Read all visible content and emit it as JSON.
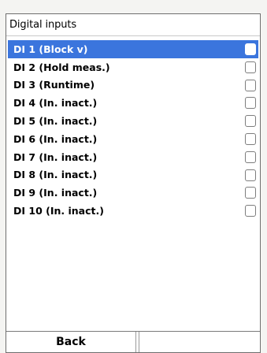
{
  "screen": {
    "title": "Digital inputs"
  },
  "items": [
    {
      "label": "DI 1 (Block v)",
      "checked": false,
      "selected": true
    },
    {
      "label": "DI 2 (Hold meas.)",
      "checked": false,
      "selected": false
    },
    {
      "label": "DI 3 (Runtime)",
      "checked": false,
      "selected": false
    },
    {
      "label": "DI 4 (In. inact.)",
      "checked": false,
      "selected": false
    },
    {
      "label": "DI 5 (In. inact.)",
      "checked": false,
      "selected": false
    },
    {
      "label": "DI 6 (In. inact.)",
      "checked": false,
      "selected": false
    },
    {
      "label": "DI 7 (In. inact.)",
      "checked": false,
      "selected": false
    },
    {
      "label": "DI 8 (In. inact.)",
      "checked": false,
      "selected": false
    },
    {
      "label": "DI 9 (In. inact.)",
      "checked": false,
      "selected": false
    },
    {
      "label": "DI 10 (In. inact.)",
      "checked": false,
      "selected": false
    }
  ],
  "softkeys": {
    "left": "Back",
    "right": ""
  },
  "colors": {
    "selection": "#3b75dd",
    "background": "#ffffff"
  }
}
